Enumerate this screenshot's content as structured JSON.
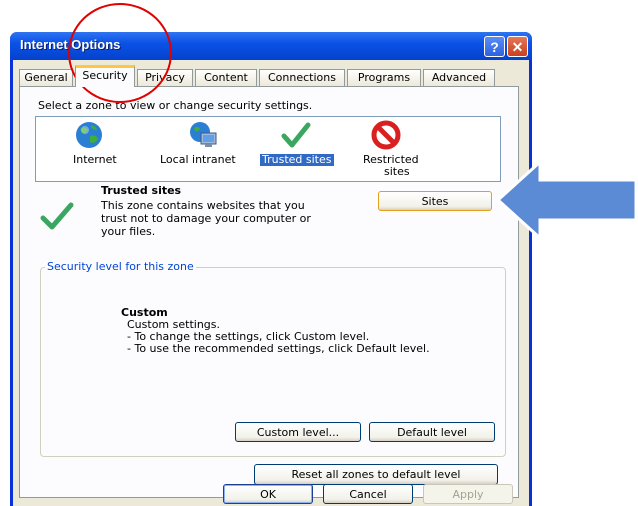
{
  "window": {
    "title": "Internet Options",
    "help_glyph": "?",
    "close_glyph": "✕"
  },
  "tabs": [
    {
      "label": "General",
      "active": false
    },
    {
      "label": "Security",
      "active": true
    },
    {
      "label": "Privacy",
      "active": false
    },
    {
      "label": "Content",
      "active": false
    },
    {
      "label": "Connections",
      "active": false
    },
    {
      "label": "Programs",
      "active": false
    },
    {
      "label": "Advanced",
      "active": false
    }
  ],
  "security": {
    "instruction": "Select a zone to view or change security settings.",
    "zones": [
      {
        "label": "Internet",
        "icon": "globe-icon",
        "selected": false
      },
      {
        "label": "Local intranet",
        "icon": "computer-globe-icon",
        "selected": false
      },
      {
        "label": "Trusted sites",
        "icon": "checkmark-icon",
        "selected": true
      },
      {
        "label": "Restricted",
        "label2": "sites",
        "icon": "restricted-icon",
        "selected": false
      }
    ],
    "selected_zone": {
      "title": "Trusted sites",
      "description_lines": [
        "This zone contains websites that you",
        "trust not to damage your computer or",
        "your files."
      ],
      "sites_button": "Sites"
    },
    "level_group": {
      "legend": "Security level for this zone",
      "level_name": "Custom",
      "lines": [
        "Custom settings.",
        "- To change the settings, click Custom level.",
        "- To use the recommended settings, click Default level."
      ],
      "custom_level_button": "Custom level...",
      "default_level_button": "Default level"
    },
    "reset_button": "Reset all zones to default level"
  },
  "footer": {
    "ok": "OK",
    "cancel": "Cancel",
    "apply": "Apply"
  },
  "colors": {
    "titlebar": "#0a52e6",
    "selection": "#316ac5",
    "annotation_circle": "#e00000",
    "annotation_arrow": "#5b8bd4"
  }
}
